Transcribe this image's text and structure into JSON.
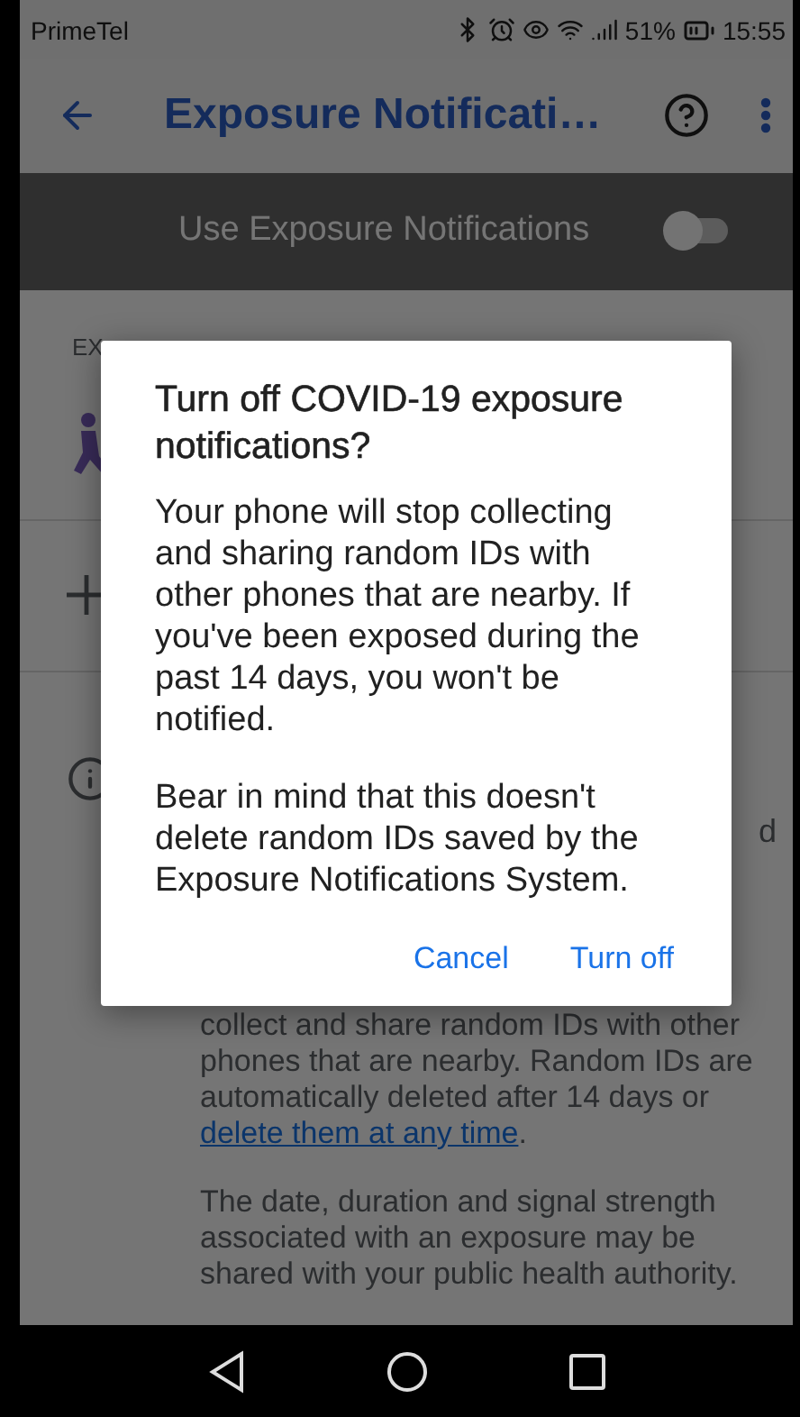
{
  "status_bar": {
    "carrier": "PrimeTel",
    "battery": "51%",
    "time": "15:55"
  },
  "app_bar": {
    "title": "Exposure Notificati…"
  },
  "master_switch": {
    "label": "Use Exposure Notifications",
    "on": false
  },
  "section_header": "EX",
  "info_row_fragment": "d",
  "background_paragraphs": [
    {
      "text": "collect and share random IDs with other phones that are nearby. Random IDs are automatically deleted after 14 days or ",
      "link": "delete them at any time",
      "after": "."
    },
    {
      "text": "The date, duration and signal strength associated with an exposure may be shared with your public health authority."
    }
  ],
  "dialog": {
    "title": "Turn off COVID-19 exposure notifications?",
    "paragraphs": [
      "Your phone will stop collecting and sharing random IDs with other phones that are nearby. If you've been exposed during the past 14 days, you won't be notified.",
      "Bear in mind that this doesn't delete random IDs saved by the Exposure Notifications System."
    ],
    "buttons": [
      "Cancel",
      "Turn off"
    ]
  }
}
